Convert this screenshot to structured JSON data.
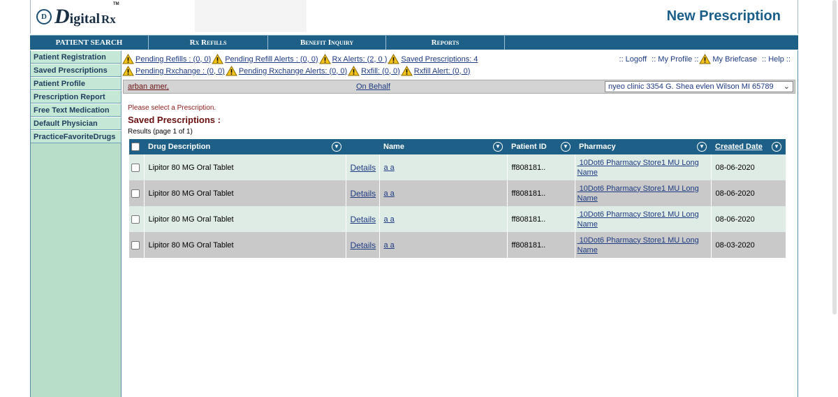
{
  "header": {
    "logo_mark": "D",
    "logo_d": "D",
    "logo_rest": "igital",
    "logo_rx": "Rx",
    "logo_tm": "TM",
    "page_title": "New Prescription"
  },
  "nav": [
    "PATIENT SEARCH",
    "Rx Refills",
    "Benefit Inquiry",
    "Reports"
  ],
  "sidebar": [
    "Patient Registration",
    "Saved Prescriptions",
    "Patient Profile",
    "Prescription Report",
    "Free Text Medication",
    "Default Physician",
    "PracticeFavoriteDrugs"
  ],
  "alerts_row1": [
    "Pending Refills : (0, 0)",
    "Pending Refill Alerts : (0, 0)",
    "Rx Alerts: (2, 0 )",
    "Saved Prescriptions: 4"
  ],
  "alerts_row2": [
    "Pending Rxchange : (0, 0)",
    "Pending Rxchange Alerts: (0, 0)",
    "Rxfill: (0, 0)",
    "Rxfill Alert: (0, 0)"
  ],
  "top_links": {
    "logoff": ":: Logoff",
    "profile": ":: My Profile ::",
    "briefcase": "My Briefcase",
    "help": ":: Help ::"
  },
  "patient_bar": {
    "patient_name": "arban amer,",
    "on_behalf": "On Behalf",
    "clinic": "nyeo clinic 3354 G. Shea evlen Wilson MI 65789"
  },
  "message": "Please select a Prescription.",
  "section_title": "Saved Prescriptions :",
  "results": "Results (page 1 of 1)",
  "table": {
    "headers": {
      "drug": "Drug Description",
      "name": "Name",
      "patient_id": "Patient ID",
      "pharmacy": "Pharmacy",
      "created": "Created Date"
    },
    "rows": [
      {
        "drug": "Lipitor 80 MG Oral Tablet",
        "details": "Details",
        "name": "a a",
        "patient_id": "ff808181..",
        "pharmacy_line1": "10Dot6 Pharmacy Store1 MU Long",
        "pharmacy_line2": "Name",
        "created": "08-06-2020"
      },
      {
        "drug": "Lipitor 80 MG Oral Tablet",
        "details": "Details",
        "name": "a a",
        "patient_id": "ff808181..",
        "pharmacy_line1": "10Dot6 Pharmacy Store1 MU Long",
        "pharmacy_line2": "Name",
        "created": "08-06-2020"
      },
      {
        "drug": "Lipitor 80 MG Oral Tablet",
        "details": "Details",
        "name": "a a",
        "patient_id": "ff808181..",
        "pharmacy_line1": "10Dot6 Pharmacy Store1 MU Long",
        "pharmacy_line2": "Name",
        "created": "08-06-2020"
      },
      {
        "drug": "Lipitor 80 MG Oral Tablet",
        "details": "Details",
        "name": "a a",
        "patient_id": "ff808181..",
        "pharmacy_line1": "10Dot6 Pharmacy Store1 MU Long",
        "pharmacy_line2": "Name",
        "created": "08-03-2020"
      }
    ]
  },
  "colors": {
    "nav_bg": "#1d5f86",
    "sidebar_bg": "#b8dec9",
    "title_blue": "#1b5e8a",
    "maroon": "#6b1010",
    "link_blue": "#1d3a82"
  },
  "icons": {
    "alert": "warning-triangle-icon",
    "sort": "chevron-down-circle-icon",
    "select": "chevron-down-icon"
  }
}
